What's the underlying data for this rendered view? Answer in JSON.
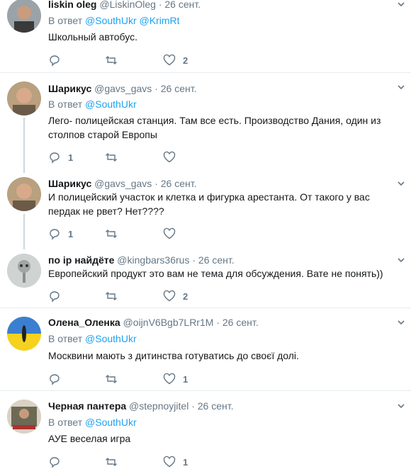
{
  "tweets": [
    {
      "name": "liskin oleg",
      "handle": "@LiskinOleg",
      "date": "26 сент.",
      "reply_prefix": "В ответ",
      "reply_to": "@SouthUkr @KrimRt",
      "text": "Школьный автобус.",
      "replies": "",
      "retweets": "",
      "likes": "2"
    },
    {
      "name": "Шарикус",
      "handle": "@gavs_gavs",
      "date": "26 сент.",
      "reply_prefix": "В ответ",
      "reply_to": "@SouthUkr",
      "text": "Лего- полицейская станция. Там все есть. Производство Дания, один из столпов старой Европы",
      "replies": "1",
      "retweets": "",
      "likes": ""
    },
    {
      "name": "Шарикус",
      "handle": "@gavs_gavs",
      "date": "26 сент.",
      "reply_prefix": "",
      "reply_to": "",
      "text": "И полицейский участок и клетка и фигурка арестанта. От такого у вас пердак не рвет? Нет????",
      "replies": "1",
      "retweets": "",
      "likes": ""
    },
    {
      "name": "по ір найдёте",
      "handle": "@kingbars36rus",
      "date": "26 сент.",
      "reply_prefix": "",
      "reply_to": "",
      "text": "Европейский продукт это вам не тема для обсуждения. Вате не понять))",
      "replies": "",
      "retweets": "",
      "likes": "2"
    },
    {
      "name": "Олена_Оленка",
      "handle": "@oijnV6Bgb7LRr1M",
      "date": "26 сент.",
      "reply_prefix": "В ответ",
      "reply_to": "@SouthUkr",
      "text": "Москвини мають з дитинства готуватись до своєї долі.",
      "replies": "",
      "retweets": "",
      "likes": "1"
    },
    {
      "name": "Черная пантера",
      "handle": "@stepnoyjitel",
      "date": "26 сент.",
      "reply_prefix": "В ответ",
      "reply_to": "@SouthUkr",
      "text": "АУЕ веселая игра",
      "replies": "",
      "retweets": "",
      "likes": "1"
    }
  ],
  "colors": {
    "accent": "#1da1f2",
    "muted": "#657786",
    "text": "#14171a",
    "separator": "#e6ecf0"
  }
}
